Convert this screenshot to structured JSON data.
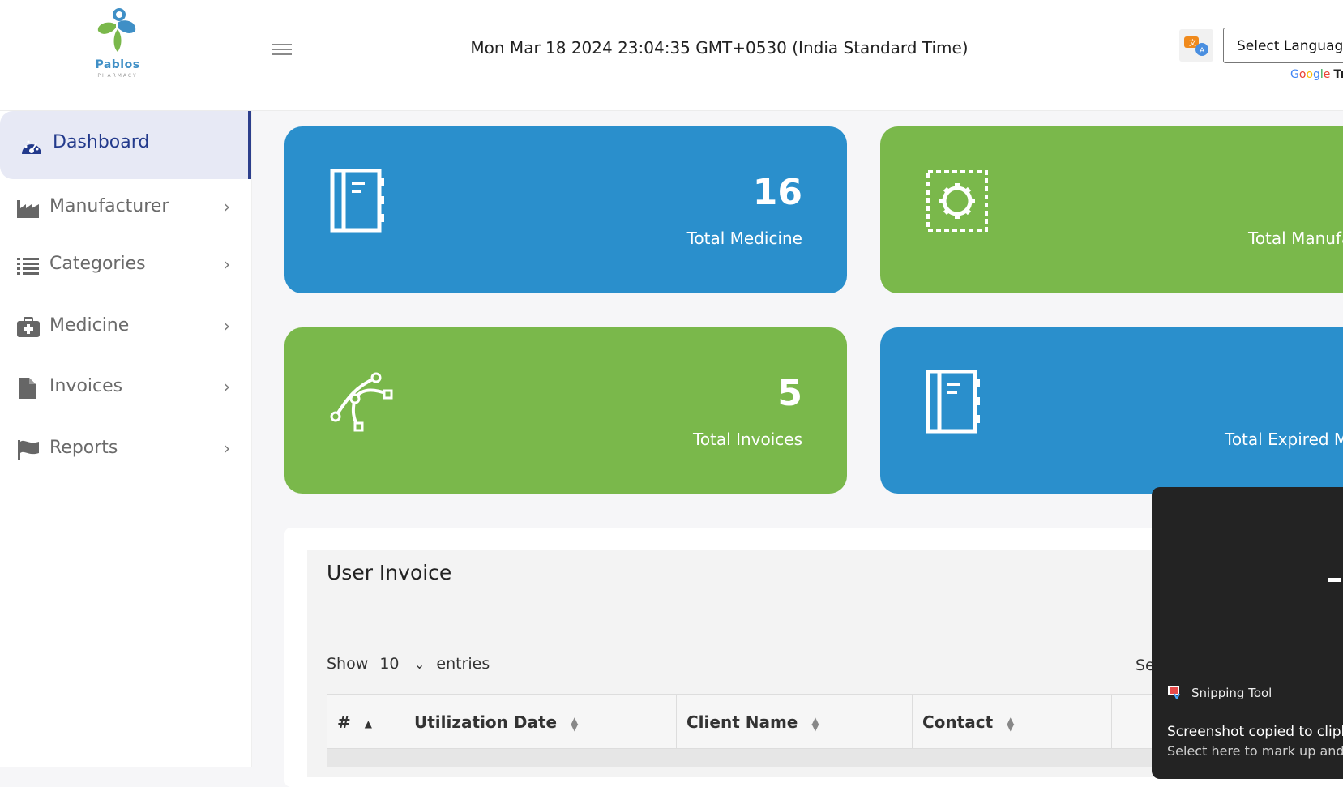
{
  "header": {
    "logo_name": "Pablos",
    "logo_sub": "PHARMACY",
    "datetime": "Mon Mar 18 2024 23:04:35 GMT+0530 (India Standard Time)",
    "language_select": "Select Language",
    "powered_by": "Google",
    "powered_suffix": "Tr"
  },
  "sidebar": {
    "items": [
      {
        "label": "Dashboard",
        "icon": "dashboard-icon",
        "active": true
      },
      {
        "label": "Manufacturer",
        "icon": "factory-icon"
      },
      {
        "label": "Categories",
        "icon": "list-icon"
      },
      {
        "label": "Medicine",
        "icon": "medkit-icon"
      },
      {
        "label": "Invoices",
        "icon": "file-icon"
      },
      {
        "label": "Reports",
        "icon": "flag-icon"
      }
    ]
  },
  "cards": [
    {
      "value": "16",
      "label": "Total Medicine",
      "color": "#2a8fcc",
      "icon": "notebook-icon"
    },
    {
      "value": "",
      "label": "Total Manufa",
      "color": "#7ab84b",
      "icon": "gear-frame-icon"
    },
    {
      "value": "5",
      "label": "Total Invoices",
      "color": "#7ab84b",
      "icon": "vector-path-icon"
    },
    {
      "value": "",
      "label": "Total Expired Me",
      "color": "#2a8fcc",
      "icon": "notebook-icon"
    }
  ],
  "invoice": {
    "title": "User Invoice",
    "show_label": "Show",
    "entries_value": "10",
    "entries_label": "entries",
    "search_label": "Se",
    "columns": [
      "#",
      "Utilization Date",
      "Client Name",
      "Contact"
    ]
  },
  "toast": {
    "app": "Snipping Tool",
    "message": "Screenshot copied to clipboa",
    "sub": "Select here to mark up and s"
  }
}
